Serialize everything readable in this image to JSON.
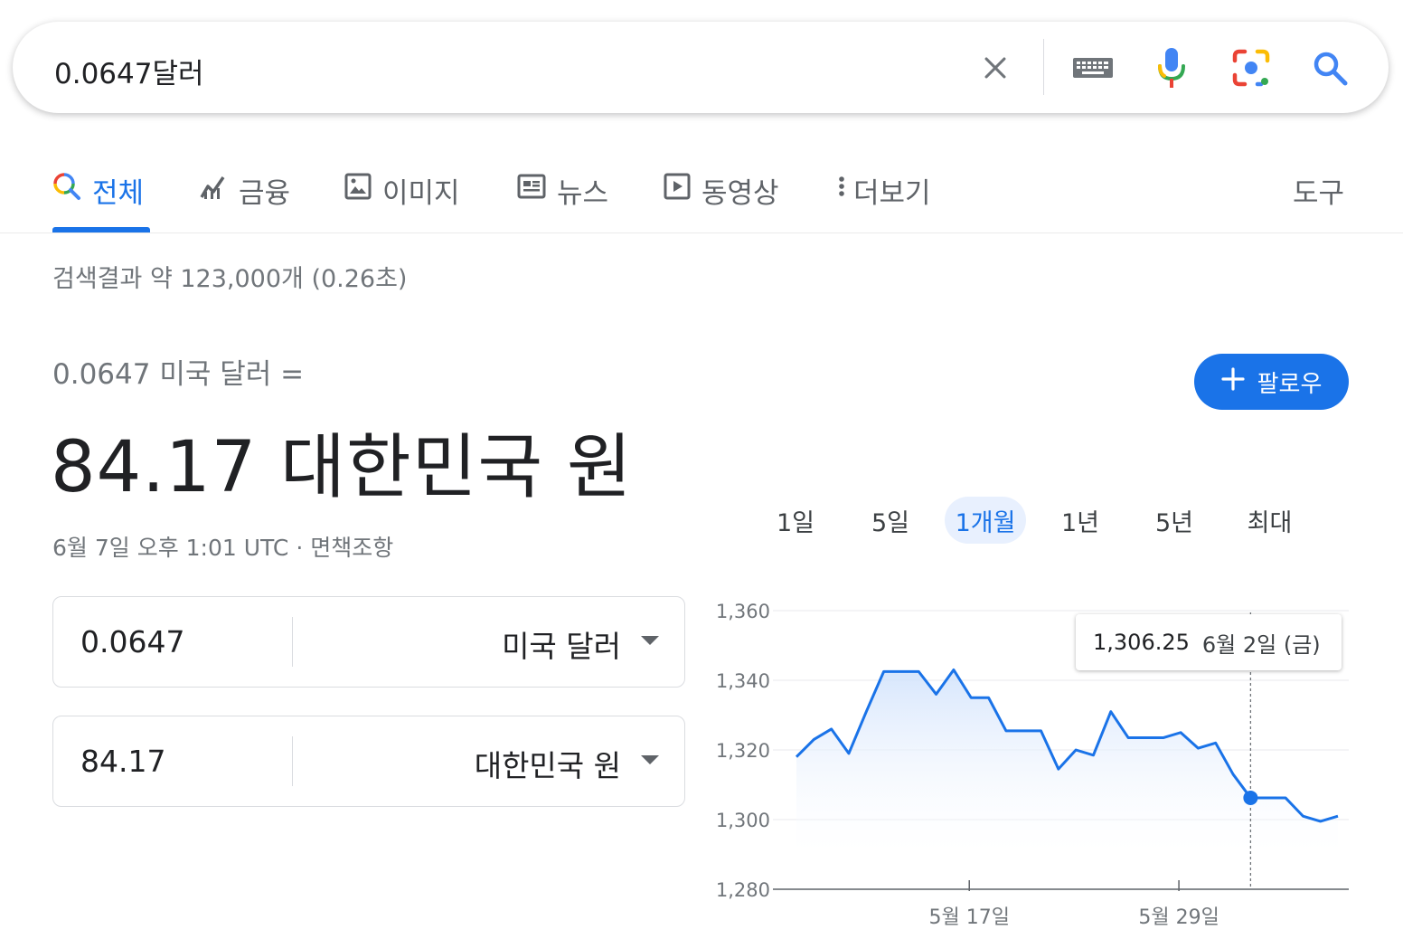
{
  "search": {
    "query": "0.0647달러"
  },
  "tabs": [
    {
      "label": "전체",
      "icon": "search-multicolor-icon",
      "active": true
    },
    {
      "label": "금융",
      "icon": "finance-chart-icon"
    },
    {
      "label": "이미지",
      "icon": "image-icon"
    },
    {
      "label": "뉴스",
      "icon": "news-icon"
    },
    {
      "label": "동영상",
      "icon": "video-play-icon"
    },
    {
      "label": "더보기",
      "icon": "more-vert-icon"
    }
  ],
  "tools_label": "도구",
  "result_stats": "검색결과 약 123,000개 (0.26초)",
  "currency": {
    "from_line": "0.0647 미국 달러 =",
    "result": "84.17 대한민국 원",
    "timestamp": "6월 7일 오후 1:01 UTC",
    "separator": "·",
    "disclaimer": "면책조항",
    "follow_label": "팔로우",
    "from_amount": "0.0647",
    "from_unit": "미국 달러",
    "to_amount": "84.17",
    "to_unit": "대한민국 원"
  },
  "ranges": [
    {
      "label": "1일"
    },
    {
      "label": "5일"
    },
    {
      "label": "1개월",
      "active": true
    },
    {
      "label": "1년"
    },
    {
      "label": "5년"
    },
    {
      "label": "최대"
    }
  ],
  "tooltip": {
    "value": "1,306.25",
    "date": "6월 2일 (금)"
  },
  "colors": {
    "accent": "#1a73e8",
    "line": "#1a73e8",
    "area_top": "#d2e3fc"
  },
  "chart_data": {
    "type": "line",
    "ylim": [
      1280,
      1360
    ],
    "yticks": [
      "1,360",
      "1,340",
      "1,320",
      "1,300",
      "1,280"
    ],
    "ytick_values": [
      1360,
      1340,
      1320,
      1300,
      1280
    ],
    "xtick_labels": [
      "5월 17일",
      "5월 29일"
    ],
    "xtick_indices": [
      10,
      22
    ],
    "highlight_index": 26,
    "series": [
      {
        "values": [
          1318,
          1323,
          1326,
          1319,
          1331,
          1342.5,
          1342.5,
          1342.5,
          1336,
          1343,
          1335,
          1335,
          1325.5,
          1325.5,
          1325.5,
          1314.5,
          1320,
          1318.5,
          1331,
          1323.5,
          1323.5,
          1323.5,
          1325,
          1320.5,
          1322,
          1313,
          1306.25,
          1306.25,
          1306.25,
          1301,
          1299.5,
          1301
        ]
      }
    ],
    "grid": true
  }
}
